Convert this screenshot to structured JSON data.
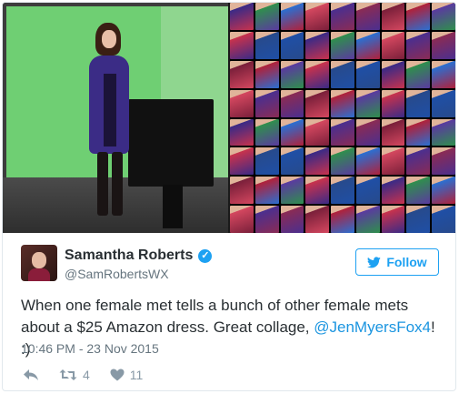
{
  "tweet": {
    "display_name": "Samantha Roberts",
    "verified_mark": "✓",
    "handle": "@SamRobertsWX",
    "follow_label": "Follow",
    "text_before": "When one female met tells a bunch of other female mets about a $25 Amazon dress. Great collage, ",
    "mention": "@JenMyersFox4",
    "text_after": "! :)",
    "timestamp": "10:46 PM - 23 Nov 2015",
    "retweet_count": "4",
    "like_count": "11"
  },
  "icons": {
    "reply": "reply-icon",
    "retweet": "retweet-icon",
    "like": "heart-icon",
    "follow": "twitter-bird-icon",
    "verified": "verified-badge-icon"
  },
  "colors": {
    "accent": "#1da1f2",
    "text": "#292f33",
    "muted": "#66757f",
    "action": "#8899a6"
  }
}
